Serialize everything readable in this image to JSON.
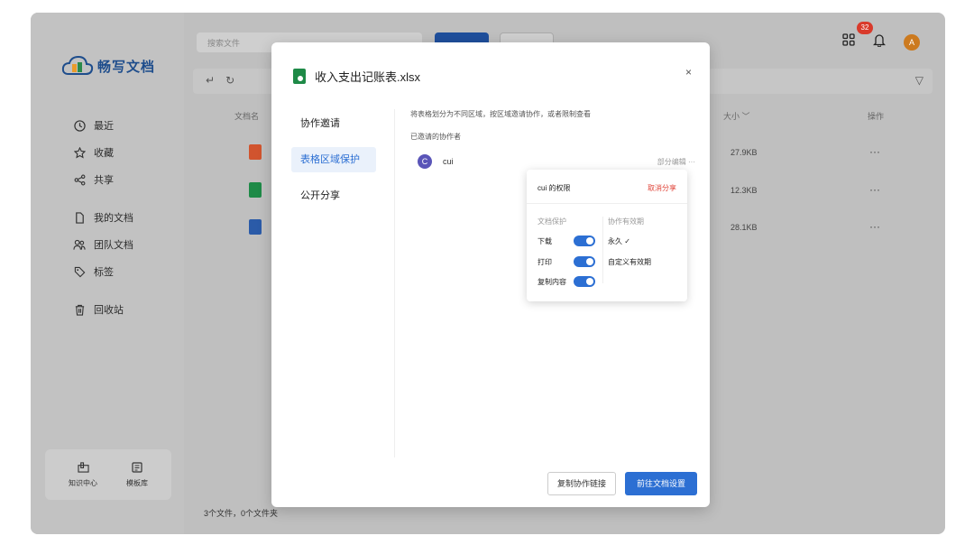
{
  "app": {
    "logo_text": "畅写文档",
    "search_placeholder": "搜索文件",
    "notification_count": "32",
    "avatar_initial": "A"
  },
  "sidebar": {
    "items": [
      {
        "label": "最近",
        "icon": "clock-icon"
      },
      {
        "label": "收藏",
        "icon": "star-icon"
      },
      {
        "label": "共享",
        "icon": "share-icon"
      },
      {
        "label": "我的文档",
        "icon": "document-icon"
      },
      {
        "label": "团队文档",
        "icon": "team-icon"
      },
      {
        "label": "标签",
        "icon": "tag-icon"
      },
      {
        "label": "回收站",
        "icon": "trash-icon"
      }
    ],
    "bottom": [
      {
        "label": "知识中心",
        "icon": "knowledge-icon"
      },
      {
        "label": "模板库",
        "icon": "template-icon"
      }
    ]
  },
  "table": {
    "columns": {
      "name": "文档名",
      "size": "大小",
      "actions": "操作"
    },
    "rows": [
      {
        "type": "ppt",
        "size": "27.9KB"
      },
      {
        "type": "xls",
        "size": "12.3KB"
      },
      {
        "type": "doc",
        "size": "28.1KB"
      }
    ],
    "more": "···"
  },
  "footer": {
    "count_text": "3个文件，0个文件夹"
  },
  "modal": {
    "title": "收入支出记账表.xlsx",
    "close": "×",
    "nav": [
      "协作邀请",
      "表格区域保护",
      "公开分享"
    ],
    "active_nav_index": 1,
    "description": "将表格划分为不同区域，按区域邀请协作，或者限制查看",
    "invited_label": "已邀请的协作者",
    "collaborator": {
      "initial": "C",
      "name": "cui",
      "permission": "部分编辑 ···"
    },
    "buttons": {
      "copy_link": "复制协作链接",
      "go_settings": "前往文档设置"
    }
  },
  "popover": {
    "title": "cui 的权限",
    "cancel_share": "取消分享",
    "doc_protection_label": "文档保护",
    "validity_label": "协作有效期",
    "permissions": [
      {
        "label": "下载",
        "enabled": true
      },
      {
        "label": "打印",
        "enabled": true
      },
      {
        "label": "复制内容",
        "enabled": true
      }
    ],
    "validity_options": [
      "永久 ✓",
      "自定义有效期"
    ]
  },
  "colors": {
    "accent": "#2c6fd3",
    "danger": "#e0463b",
    "ppt": "#d1542e",
    "xls": "#1e8a47",
    "doc": "#2b5ba8"
  }
}
